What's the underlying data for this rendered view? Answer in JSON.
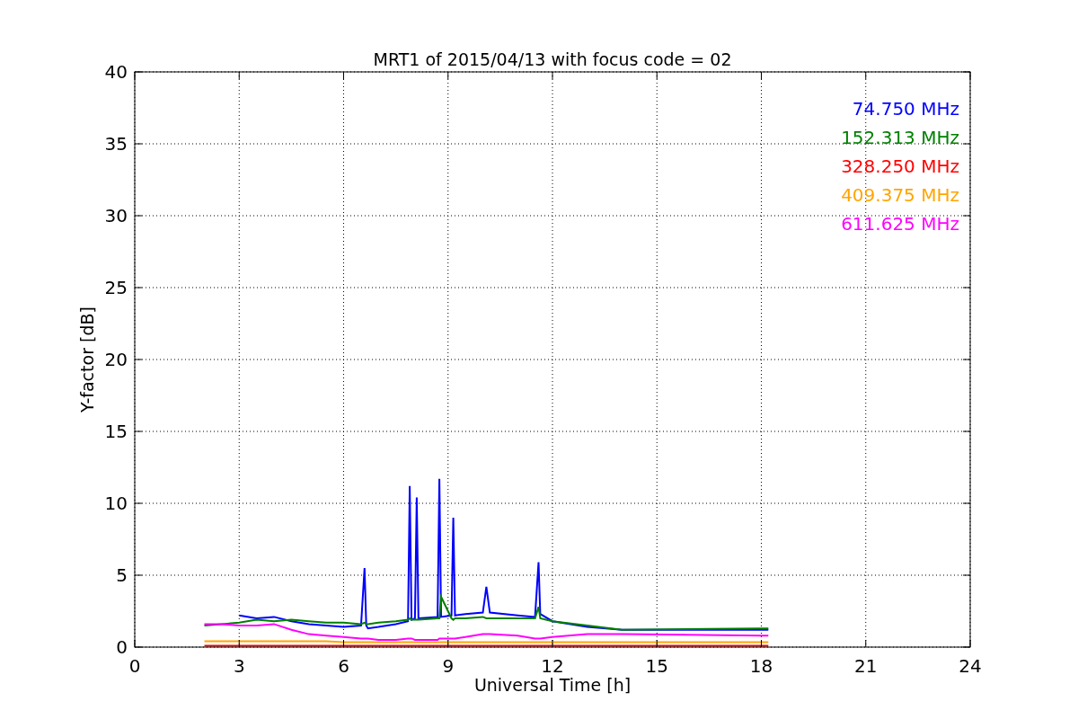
{
  "chart_data": {
    "type": "line",
    "grid": true,
    "title": "MRT1 of 2015/04/13 with focus code = 02",
    "xlabel": "Universal Time [h]",
    "ylabel": "Y-factor [dB]",
    "x": [
      2,
      2.5,
      3,
      3.5,
      4,
      4.5,
      5,
      5.5,
      6,
      6.5,
      6.6,
      6.65,
      6.7,
      7,
      7.5,
      7.85,
      7.9,
      7.95,
      8.05,
      8.1,
      8.15,
      8.7,
      8.75,
      8.8,
      9.1,
      9.15,
      9.2,
      9.5,
      10,
      10.1,
      10.2,
      11,
      11.5,
      11.6,
      11.65,
      12,
      13,
      14,
      18,
      18.2
    ],
    "series": [
      {
        "name": "74.750 MHz",
        "color": "#0000ff",
        "values": [
          null,
          null,
          2.2,
          2.0,
          2.1,
          1.8,
          1.6,
          1.5,
          1.4,
          1.5,
          5.5,
          1.5,
          1.3,
          1.4,
          1.6,
          1.8,
          11.2,
          1.9,
          2.0,
          10.4,
          2.0,
          2.1,
          11.7,
          2.1,
          2.2,
          9.0,
          2.2,
          2.3,
          2.4,
          4.2,
          2.4,
          2.2,
          2.1,
          5.9,
          2.3,
          1.8,
          1.4,
          1.2,
          1.2,
          1.2
        ]
      },
      {
        "name": "152.313 MHz",
        "color": "#008000",
        "values": [
          1.5,
          1.6,
          1.7,
          1.9,
          1.8,
          1.9,
          1.8,
          1.7,
          1.7,
          1.6,
          1.7,
          1.6,
          1.6,
          1.7,
          1.8,
          1.9,
          2.0,
          1.9,
          1.9,
          1.9,
          1.9,
          2.0,
          2.0,
          3.5,
          2.0,
          1.9,
          2.0,
          2.0,
          2.1,
          2.0,
          2.0,
          2.0,
          2.0,
          2.8,
          2.0,
          1.8,
          1.5,
          1.2,
          1.3,
          1.3
        ]
      },
      {
        "name": "328.250 MHz",
        "color": "#ff0000",
        "values": [
          0.1,
          0.1,
          0.1,
          0.1,
          0.1,
          0.1,
          0.1,
          0.1,
          0.1,
          0.1,
          0.1,
          0.1,
          0.1,
          0.1,
          0.1,
          0.1,
          0.1,
          0.1,
          0.1,
          0.1,
          0.1,
          0.1,
          0.1,
          0.1,
          0.1,
          0.1,
          0.1,
          0.1,
          0.1,
          0.1,
          0.1,
          0.1,
          0.1,
          0.1,
          0.1,
          0.1,
          0.1,
          0.1,
          0.1,
          0.1
        ]
      },
      {
        "name": "409.375 MHz",
        "color": "#ffa500",
        "values": [
          0.4,
          0.4,
          0.4,
          0.4,
          0.4,
          0.4,
          0.4,
          0.4,
          0.35,
          0.35,
          0.35,
          0.35,
          0.35,
          0.35,
          0.35,
          0.35,
          0.35,
          0.35,
          0.35,
          0.35,
          0.35,
          0.35,
          0.35,
          0.35,
          0.35,
          0.35,
          0.35,
          0.35,
          0.35,
          0.35,
          0.35,
          0.35,
          0.35,
          0.35,
          0.35,
          0.35,
          0.35,
          0.35,
          0.35,
          0.35
        ]
      },
      {
        "name": "611.625 MHz",
        "color": "#ff00ff",
        "values": [
          1.6,
          1.6,
          1.5,
          1.5,
          1.6,
          1.2,
          0.9,
          0.8,
          0.7,
          0.6,
          0.6,
          0.6,
          0.6,
          0.5,
          0.5,
          0.6,
          0.6,
          0.6,
          0.5,
          0.5,
          0.5,
          0.5,
          0.6,
          0.6,
          0.6,
          0.6,
          0.6,
          0.7,
          0.9,
          0.9,
          0.9,
          0.8,
          0.6,
          0.6,
          0.6,
          0.7,
          0.9,
          0.9,
          0.8,
          0.8
        ]
      }
    ],
    "xlim": [
      0,
      24
    ],
    "ylim": [
      0,
      40
    ],
    "xticks": [
      0,
      3,
      6,
      9,
      12,
      15,
      18,
      21,
      24
    ],
    "yticks": [
      0,
      5,
      10,
      15,
      20,
      25,
      30,
      35,
      40
    ]
  }
}
